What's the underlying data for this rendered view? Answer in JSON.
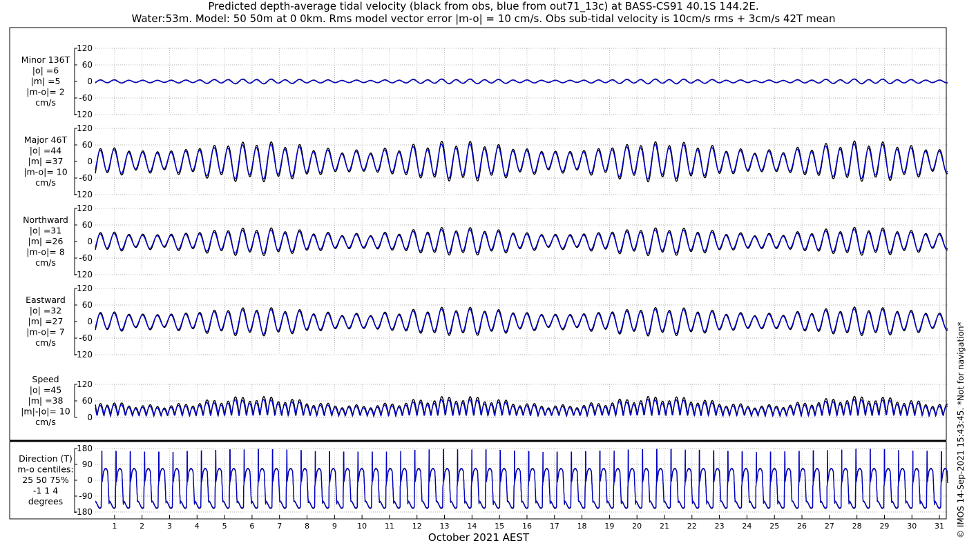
{
  "title_line1": "Predicted depth-average tidal velocity (black from obs, blue from out71_13c) at BASS-CS91 40.1S 144.2E.",
  "title_line2": "Water:53m. Model: 50 50m at 0 0km. Rms model vector error |m-o| = 10 cm/s. Obs sub-tidal velocity is 10cm/s rms + 3cm/s 42T mean",
  "copyright": "© IMOS 14-Sep-2021 15:43:45. *Not for navigation*",
  "colors": {
    "obs": "#000000",
    "model": "#0000cc",
    "grid": "#999999"
  },
  "chart_data": {
    "type": "line",
    "xlabel": "October 2021 AEST",
    "x_ticks": [
      1,
      2,
      3,
      4,
      5,
      6,
      7,
      8,
      9,
      10,
      11,
      12,
      13,
      14,
      15,
      16,
      17,
      18,
      19,
      20,
      21,
      22,
      23,
      24,
      25,
      26,
      27,
      28,
      29,
      30,
      31
    ],
    "xlim": [
      0.3,
      31.3
    ],
    "series_names": [
      "obs",
      "model"
    ],
    "panels": [
      {
        "name": "minor",
        "label": [
          "Minor 136T",
          "|o| =6",
          "|m| =5",
          "|m-o|= 2",
          "cm/s"
        ],
        "ylim": [
          -120,
          120
        ],
        "yticks": [
          120,
          60,
          0,
          -60,
          -120
        ],
        "obs_amp": 8,
        "mod_amp": 7,
        "kind": "vel"
      },
      {
        "name": "major",
        "label": [
          "Major 46T",
          "|o| =44",
          "|m| =37",
          "|m-o|= 10",
          "cm/s"
        ],
        "ylim": [
          -120,
          120
        ],
        "yticks": [
          120,
          60,
          0,
          -60,
          -120
        ],
        "obs_amp": 65,
        "mod_amp": 56,
        "kind": "vel"
      },
      {
        "name": "northward",
        "label": [
          "Northward",
          "|o| =31",
          "|m| =26",
          "|m-o|= 8",
          "cm/s"
        ],
        "ylim": [
          -120,
          120
        ],
        "yticks": [
          120,
          60,
          0,
          -60,
          -120
        ],
        "obs_amp": 45,
        "mod_amp": 38,
        "kind": "vel"
      },
      {
        "name": "eastward",
        "label": [
          "Eastward",
          "|o| =32",
          "|m| =27",
          "|m-o|= 7",
          "cm/s"
        ],
        "ylim": [
          -120,
          120
        ],
        "yticks": [
          120,
          60,
          0,
          -60,
          -120
        ],
        "obs_amp": 46,
        "mod_amp": 40,
        "kind": "vel"
      },
      {
        "name": "speed",
        "label": [
          "Speed",
          "|o| =45",
          "|m| =38",
          "|m|-|o|= 10",
          "cm/s"
        ],
        "ylim": [
          0,
          120
        ],
        "yticks": [
          120,
          60,
          0
        ],
        "obs_amp": 65,
        "mod_amp": 55,
        "kind": "speed"
      },
      {
        "name": "direction",
        "label": [
          "Direction (T)",
          "m-o centiles:",
          "25  50  75%",
          "-1  1  4",
          "degrees"
        ],
        "ylim": [
          -180,
          180
        ],
        "yticks": [
          180,
          90,
          0,
          -90,
          -180
        ],
        "kind": "dir"
      }
    ]
  }
}
